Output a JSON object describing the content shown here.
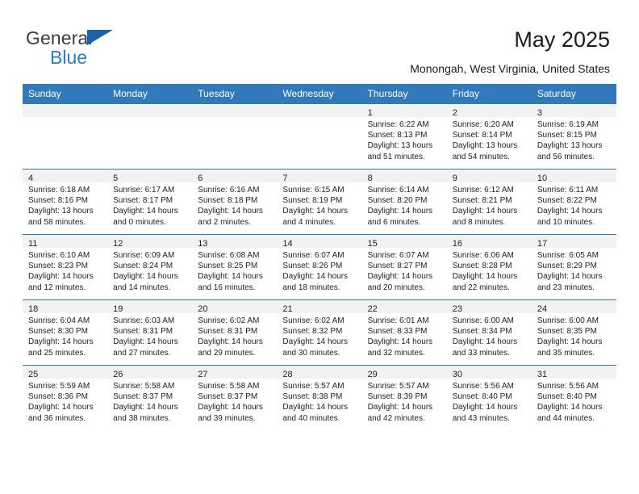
{
  "brand": {
    "line1": "General",
    "line2": "Blue",
    "triangle_color": "#1565a8",
    "blue_color": "#1f7fd0"
  },
  "header": {
    "title": "May 2025",
    "subtitle": "Monongah, West Virginia, United States"
  },
  "theme": {
    "header_bar": "#3079ba",
    "daynum_band": "#f2f2f2",
    "text": "#222222"
  },
  "weekday_headers": [
    "Sunday",
    "Monday",
    "Tuesday",
    "Wednesday",
    "Thursday",
    "Friday",
    "Saturday"
  ],
  "labels": {
    "sunrise_prefix": "Sunrise:",
    "sunset_prefix": "Sunset:",
    "daylight_prefix": "Daylight:"
  },
  "weeks": [
    [
      {
        "day": ""
      },
      {
        "day": ""
      },
      {
        "day": ""
      },
      {
        "day": ""
      },
      {
        "day": "1",
        "sunrise": "Sunrise: 6:22 AM",
        "sunset": "Sunset: 8:13 PM",
        "daylight1": "Daylight: 13 hours",
        "daylight2": "and 51 minutes."
      },
      {
        "day": "2",
        "sunrise": "Sunrise: 6:20 AM",
        "sunset": "Sunset: 8:14 PM",
        "daylight1": "Daylight: 13 hours",
        "daylight2": "and 54 minutes."
      },
      {
        "day": "3",
        "sunrise": "Sunrise: 6:19 AM",
        "sunset": "Sunset: 8:15 PM",
        "daylight1": "Daylight: 13 hours",
        "daylight2": "and 56 minutes."
      }
    ],
    [
      {
        "day": "4",
        "sunrise": "Sunrise: 6:18 AM",
        "sunset": "Sunset: 8:16 PM",
        "daylight1": "Daylight: 13 hours",
        "daylight2": "and 58 minutes."
      },
      {
        "day": "5",
        "sunrise": "Sunrise: 6:17 AM",
        "sunset": "Sunset: 8:17 PM",
        "daylight1": "Daylight: 14 hours",
        "daylight2": "and 0 minutes."
      },
      {
        "day": "6",
        "sunrise": "Sunrise: 6:16 AM",
        "sunset": "Sunset: 8:18 PM",
        "daylight1": "Daylight: 14 hours",
        "daylight2": "and 2 minutes."
      },
      {
        "day": "7",
        "sunrise": "Sunrise: 6:15 AM",
        "sunset": "Sunset: 8:19 PM",
        "daylight1": "Daylight: 14 hours",
        "daylight2": "and 4 minutes."
      },
      {
        "day": "8",
        "sunrise": "Sunrise: 6:14 AM",
        "sunset": "Sunset: 8:20 PM",
        "daylight1": "Daylight: 14 hours",
        "daylight2": "and 6 minutes."
      },
      {
        "day": "9",
        "sunrise": "Sunrise: 6:12 AM",
        "sunset": "Sunset: 8:21 PM",
        "daylight1": "Daylight: 14 hours",
        "daylight2": "and 8 minutes."
      },
      {
        "day": "10",
        "sunrise": "Sunrise: 6:11 AM",
        "sunset": "Sunset: 8:22 PM",
        "daylight1": "Daylight: 14 hours",
        "daylight2": "and 10 minutes."
      }
    ],
    [
      {
        "day": "11",
        "sunrise": "Sunrise: 6:10 AM",
        "sunset": "Sunset: 8:23 PM",
        "daylight1": "Daylight: 14 hours",
        "daylight2": "and 12 minutes."
      },
      {
        "day": "12",
        "sunrise": "Sunrise: 6:09 AM",
        "sunset": "Sunset: 8:24 PM",
        "daylight1": "Daylight: 14 hours",
        "daylight2": "and 14 minutes."
      },
      {
        "day": "13",
        "sunrise": "Sunrise: 6:08 AM",
        "sunset": "Sunset: 8:25 PM",
        "daylight1": "Daylight: 14 hours",
        "daylight2": "and 16 minutes."
      },
      {
        "day": "14",
        "sunrise": "Sunrise: 6:07 AM",
        "sunset": "Sunset: 8:26 PM",
        "daylight1": "Daylight: 14 hours",
        "daylight2": "and 18 minutes."
      },
      {
        "day": "15",
        "sunrise": "Sunrise: 6:07 AM",
        "sunset": "Sunset: 8:27 PM",
        "daylight1": "Daylight: 14 hours",
        "daylight2": "and 20 minutes."
      },
      {
        "day": "16",
        "sunrise": "Sunrise: 6:06 AM",
        "sunset": "Sunset: 8:28 PM",
        "daylight1": "Daylight: 14 hours",
        "daylight2": "and 22 minutes."
      },
      {
        "day": "17",
        "sunrise": "Sunrise: 6:05 AM",
        "sunset": "Sunset: 8:29 PM",
        "daylight1": "Daylight: 14 hours",
        "daylight2": "and 23 minutes."
      }
    ],
    [
      {
        "day": "18",
        "sunrise": "Sunrise: 6:04 AM",
        "sunset": "Sunset: 8:30 PM",
        "daylight1": "Daylight: 14 hours",
        "daylight2": "and 25 minutes."
      },
      {
        "day": "19",
        "sunrise": "Sunrise: 6:03 AM",
        "sunset": "Sunset: 8:31 PM",
        "daylight1": "Daylight: 14 hours",
        "daylight2": "and 27 minutes."
      },
      {
        "day": "20",
        "sunrise": "Sunrise: 6:02 AM",
        "sunset": "Sunset: 8:31 PM",
        "daylight1": "Daylight: 14 hours",
        "daylight2": "and 29 minutes."
      },
      {
        "day": "21",
        "sunrise": "Sunrise: 6:02 AM",
        "sunset": "Sunset: 8:32 PM",
        "daylight1": "Daylight: 14 hours",
        "daylight2": "and 30 minutes."
      },
      {
        "day": "22",
        "sunrise": "Sunrise: 6:01 AM",
        "sunset": "Sunset: 8:33 PM",
        "daylight1": "Daylight: 14 hours",
        "daylight2": "and 32 minutes."
      },
      {
        "day": "23",
        "sunrise": "Sunrise: 6:00 AM",
        "sunset": "Sunset: 8:34 PM",
        "daylight1": "Daylight: 14 hours",
        "daylight2": "and 33 minutes."
      },
      {
        "day": "24",
        "sunrise": "Sunrise: 6:00 AM",
        "sunset": "Sunset: 8:35 PM",
        "daylight1": "Daylight: 14 hours",
        "daylight2": "and 35 minutes."
      }
    ],
    [
      {
        "day": "25",
        "sunrise": "Sunrise: 5:59 AM",
        "sunset": "Sunset: 8:36 PM",
        "daylight1": "Daylight: 14 hours",
        "daylight2": "and 36 minutes."
      },
      {
        "day": "26",
        "sunrise": "Sunrise: 5:58 AM",
        "sunset": "Sunset: 8:37 PM",
        "daylight1": "Daylight: 14 hours",
        "daylight2": "and 38 minutes."
      },
      {
        "day": "27",
        "sunrise": "Sunrise: 5:58 AM",
        "sunset": "Sunset: 8:37 PM",
        "daylight1": "Daylight: 14 hours",
        "daylight2": "and 39 minutes."
      },
      {
        "day": "28",
        "sunrise": "Sunrise: 5:57 AM",
        "sunset": "Sunset: 8:38 PM",
        "daylight1": "Daylight: 14 hours",
        "daylight2": "and 40 minutes."
      },
      {
        "day": "29",
        "sunrise": "Sunrise: 5:57 AM",
        "sunset": "Sunset: 8:39 PM",
        "daylight1": "Daylight: 14 hours",
        "daylight2": "and 42 minutes."
      },
      {
        "day": "30",
        "sunrise": "Sunrise: 5:56 AM",
        "sunset": "Sunset: 8:40 PM",
        "daylight1": "Daylight: 14 hours",
        "daylight2": "and 43 minutes."
      },
      {
        "day": "31",
        "sunrise": "Sunrise: 5:56 AM",
        "sunset": "Sunset: 8:40 PM",
        "daylight1": "Daylight: 14 hours",
        "daylight2": "and 44 minutes."
      }
    ]
  ]
}
